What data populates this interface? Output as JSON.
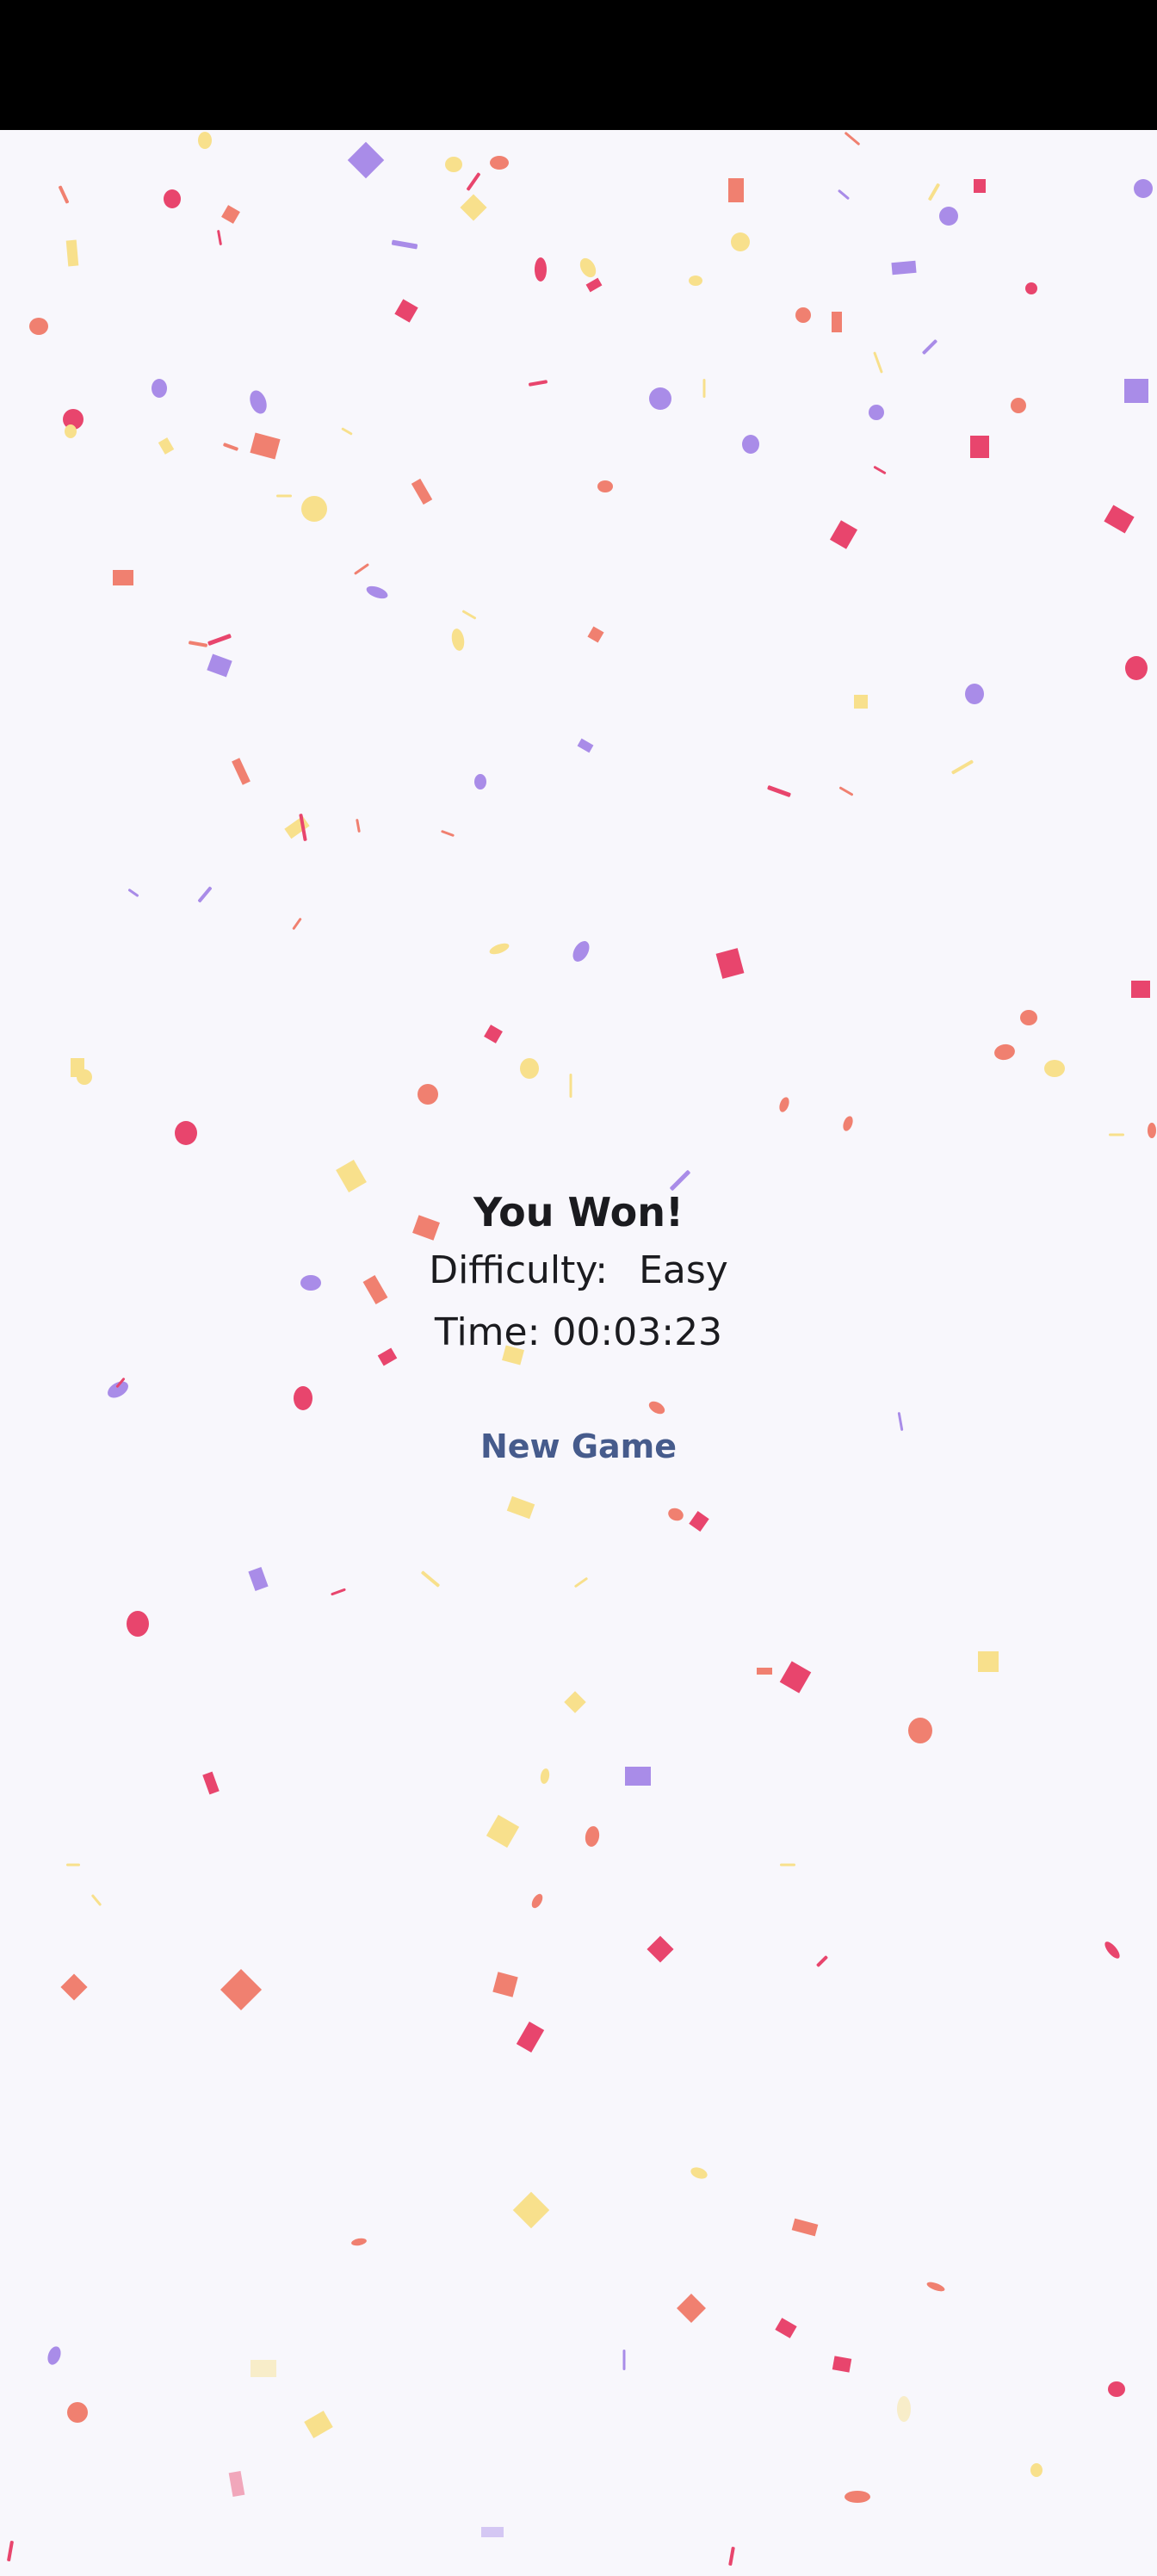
{
  "result": {
    "title": "You Won!",
    "difficulty_label": "Difficulty:",
    "difficulty_value": "Easy",
    "time_label": "Time:",
    "time_value": "00:03:23"
  },
  "actions": {
    "new_game_label": "New Game"
  },
  "colors": {
    "background": "#f8f7fc",
    "status_bar": "#000000",
    "text": "#1b1b1f",
    "button_text": "#465b8c",
    "confetti": [
      "#e8456d",
      "#f08070",
      "#a98ce8",
      "#f8e08c"
    ]
  }
}
